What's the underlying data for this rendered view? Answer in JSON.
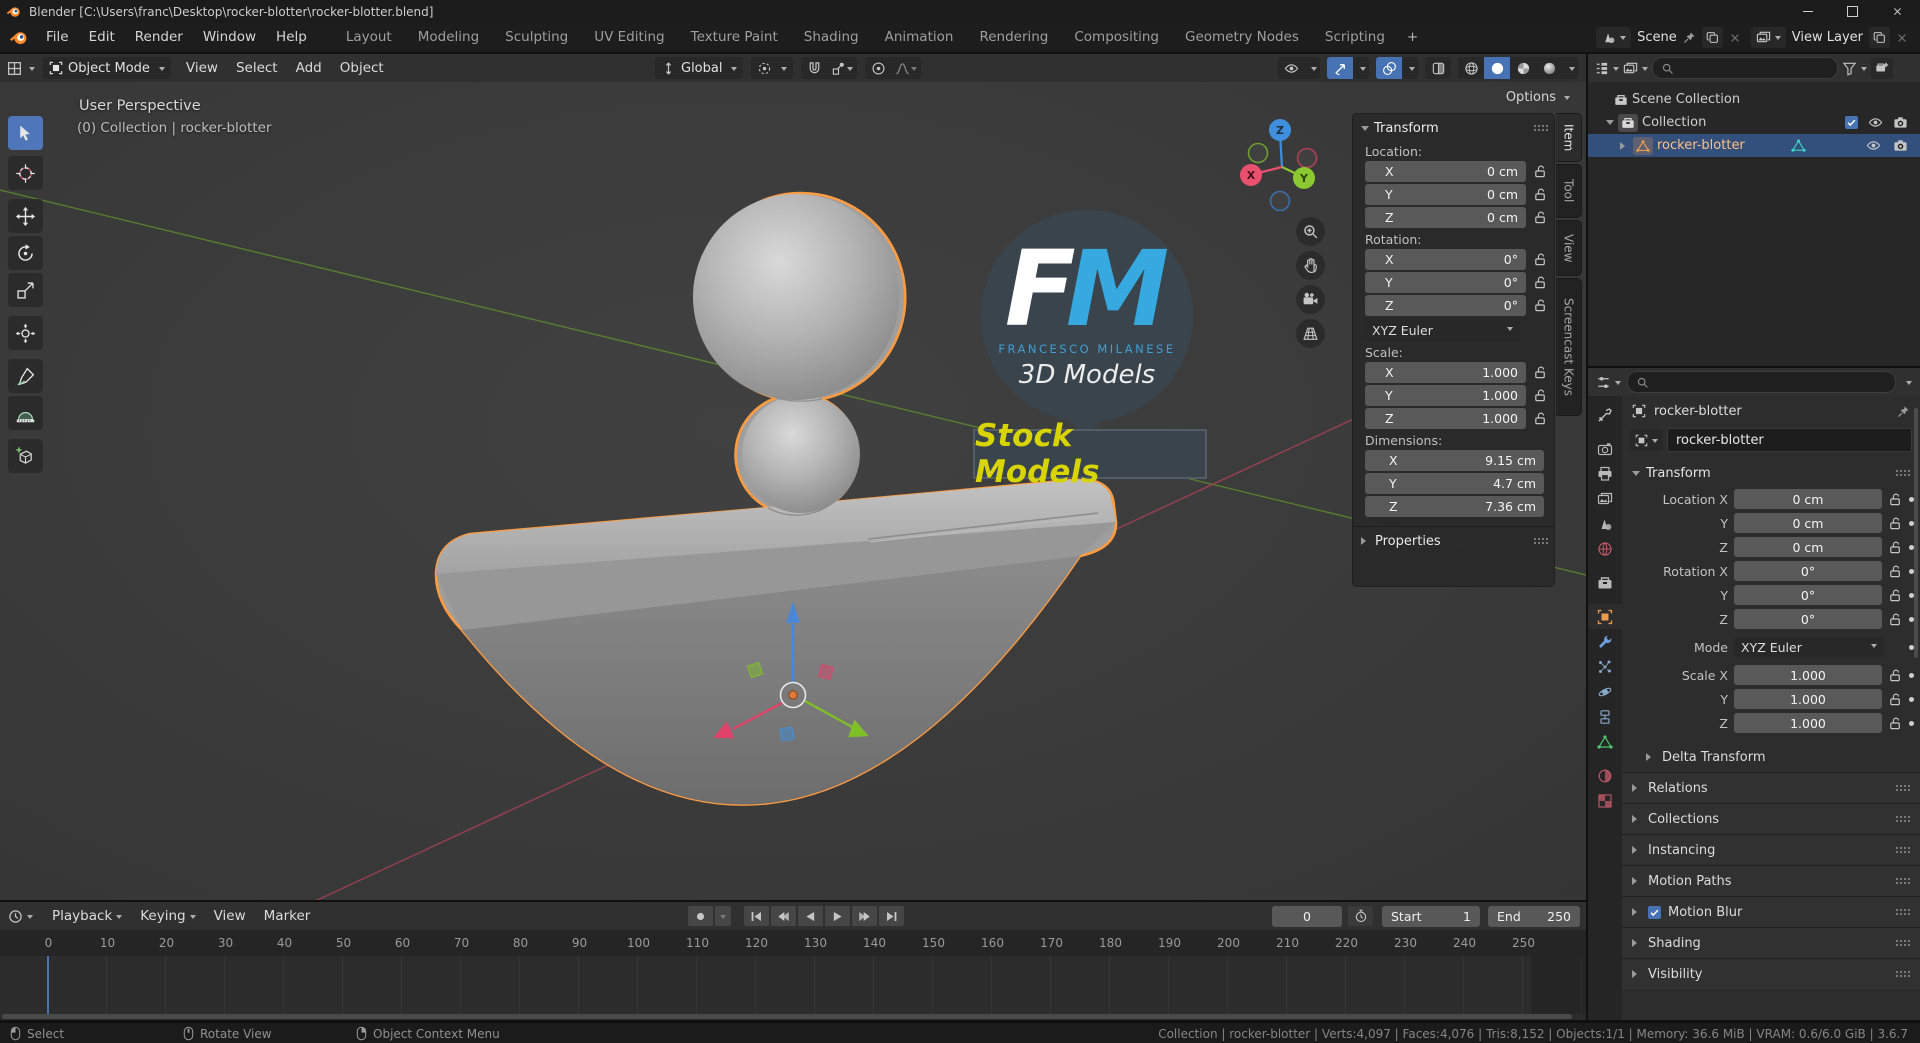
{
  "window": {
    "title": "Blender [C:\\Users\\franc\\Desktop\\rocker-blotter\\rocker-blotter.blend]"
  },
  "topbar": {
    "menus": [
      "File",
      "Edit",
      "Render",
      "Window",
      "Help"
    ],
    "workspaces": [
      "Layout",
      "Modeling",
      "Sculpting",
      "UV Editing",
      "Texture Paint",
      "Shading",
      "Animation",
      "Rendering",
      "Compositing",
      "Geometry Nodes",
      "Scripting"
    ],
    "active_workspace": "Layout",
    "add_workspace": "+",
    "scene_label": "Scene",
    "view_layer_label": "View Layer"
  },
  "tool_header": {
    "mode": "Object Mode",
    "menus": [
      "View",
      "Select",
      "Add",
      "Object"
    ],
    "orientation": "Global",
    "options_label": "Options"
  },
  "viewport": {
    "header_line1": "User Perspective",
    "header_line2": "(0) Collection | rocker-blotter",
    "watermark": {
      "f": "F",
      "m": "M",
      "name": "FRANCESCO MILANESE",
      "line": "3D Models",
      "banner": "Stock Models"
    },
    "gizmo_axes": {
      "x": "X",
      "y": "Y",
      "z": "Z"
    }
  },
  "n_panel": {
    "tabs": [
      "Item",
      "Tool",
      "View",
      "Screencast Keys"
    ],
    "active_tab": "Item",
    "transform_title": "Transform",
    "location_label": "Location:",
    "location_rows": [
      {
        "axis": "X",
        "value": "0 cm"
      },
      {
        "axis": "Y",
        "value": "0 cm"
      },
      {
        "axis": "Z",
        "value": "0 cm"
      }
    ],
    "rotation_label": "Rotation:",
    "rotation_rows": [
      {
        "axis": "X",
        "value": "0°"
      },
      {
        "axis": "Y",
        "value": "0°"
      },
      {
        "axis": "Z",
        "value": "0°"
      }
    ],
    "euler_mode": "XYZ Euler",
    "scale_label": "Scale:",
    "scale_rows": [
      {
        "axis": "X",
        "value": "1.000"
      },
      {
        "axis": "Y",
        "value": "1.000"
      },
      {
        "axis": "Z",
        "value": "1.000"
      }
    ],
    "dimensions_label": "Dimensions:",
    "dimension_rows": [
      {
        "axis": "X",
        "value": "9.15 cm"
      },
      {
        "axis": "Y",
        "value": "4.7 cm"
      },
      {
        "axis": "Z",
        "value": "7.36 cm"
      }
    ],
    "properties_label": "Properties"
  },
  "outliner": {
    "rows": [
      {
        "label": "Scene Collection"
      },
      {
        "label": "Collection"
      },
      {
        "label": "rocker-blotter"
      }
    ]
  },
  "properties": {
    "breadcrumb": "rocker-blotter",
    "name_value": "rocker-blotter",
    "transform_title": "Transform",
    "transform_rows": [
      {
        "label": "Location X",
        "value": "0 cm"
      },
      {
        "label": "Y",
        "value": "0 cm"
      },
      {
        "label": "Z",
        "value": "0 cm"
      },
      {
        "label": "Rotation X",
        "value": "0°"
      },
      {
        "label": "Y",
        "value": "0°"
      },
      {
        "label": "Z",
        "value": "0°"
      }
    ],
    "mode_label": "Mode",
    "mode_value": "XYZ Euler",
    "scale_rows": [
      {
        "label": "Scale X",
        "value": "1.000"
      },
      {
        "label": "Y",
        "value": "1.000"
      },
      {
        "label": "Z",
        "value": "1.000"
      }
    ],
    "delta_label": "Delta Transform",
    "sections_a": [
      "Relations",
      "Collections",
      "Instancing",
      "Motion Paths"
    ],
    "motion_blur_label": "Motion Blur",
    "sections_b": [
      "Shading",
      "Visibility"
    ]
  },
  "timeline": {
    "menus": [
      "Playback",
      "Keying",
      "View",
      "Marker"
    ],
    "current_frame": "0",
    "start_label": "Start",
    "start_value": "1",
    "end_label": "End",
    "end_value": "250",
    "ruler_labels": [
      "0",
      "10",
      "20",
      "30",
      "40",
      "50",
      "60",
      "70",
      "80",
      "90",
      "100",
      "110",
      "120",
      "130",
      "140",
      "150",
      "160",
      "170",
      "180",
      "190",
      "200",
      "210",
      "220",
      "230",
      "240",
      "250"
    ]
  },
  "status_bar": {
    "hints": [
      {
        "label": "Select"
      },
      {
        "label": "Rotate View"
      },
      {
        "label": "Object Context Menu"
      }
    ],
    "stats": "Collection | rocker-blotter | Verts:4,097 | Faces:4,076 | Tris:8,152 | Objects:1/1 | Memory: 36.6 MiB | VRAM: 0.6/6.0 GiB | 3.6.7"
  },
  "colors": {
    "accent_blue": "#4772b3",
    "selection_blue": "#33507d",
    "object_outline_orange": "#ff9b40",
    "axis_x_red": "#e8506e",
    "axis_y_green": "#8bc832",
    "axis_z_blue": "#3f8fde",
    "logo_blue": "#35a9e0",
    "banner_yellow": "#d8d400"
  }
}
